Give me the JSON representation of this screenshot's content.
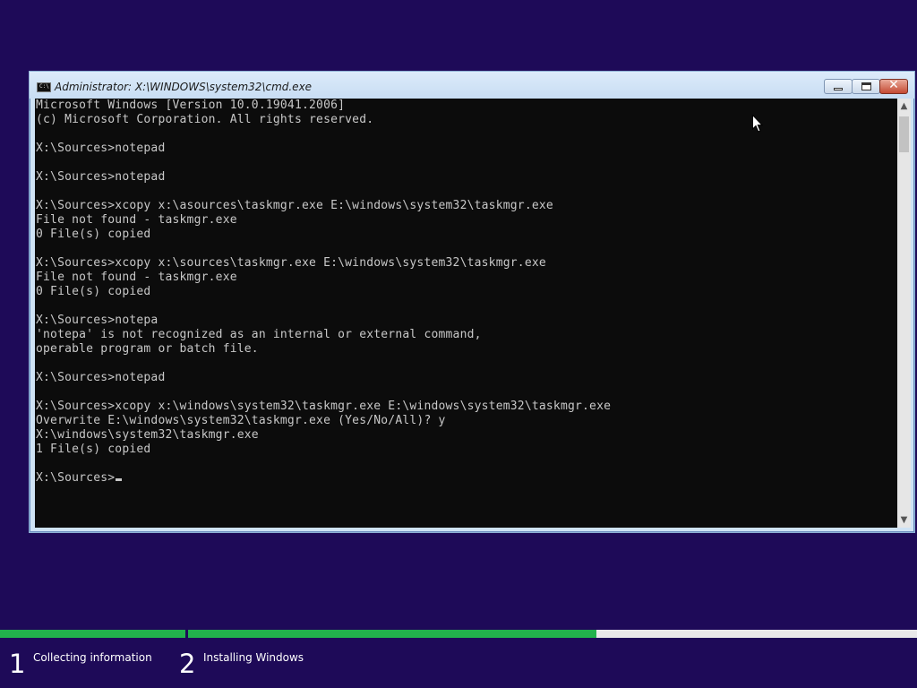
{
  "window": {
    "title": "Administrator: X:\\WINDOWS\\system32\\cmd.exe",
    "icon": "cmd-prompt-icon",
    "icon_text": "C:\\",
    "close_glyph": "✕"
  },
  "console": {
    "lines": [
      "Microsoft Windows [Version 10.0.19041.2006]",
      "(c) Microsoft Corporation. All rights reserved.",
      "",
      "X:\\Sources>notepad",
      "",
      "X:\\Sources>notepad",
      "",
      "X:\\Sources>xcopy x:\\asources\\taskmgr.exe E:\\windows\\system32\\taskmgr.exe",
      "File not found - taskmgr.exe",
      "0 File(s) copied",
      "",
      "X:\\Sources>xcopy x:\\sources\\taskmgr.exe E:\\windows\\system32\\taskmgr.exe",
      "File not found - taskmgr.exe",
      "0 File(s) copied",
      "",
      "X:\\Sources>notepa",
      "'notepa' is not recognized as an internal or external command,",
      "operable program or batch file.",
      "",
      "X:\\Sources>notepad",
      "",
      "X:\\Sources>xcopy x:\\windows\\system32\\taskmgr.exe E:\\windows\\system32\\taskmgr.exe",
      "Overwrite E:\\windows\\system32\\taskmgr.exe (Yes/No/All)? y",
      "X:\\windows\\system32\\taskmgr.exe",
      "1 File(s) copied",
      ""
    ],
    "prompt": "X:\\Sources>",
    "foreground": "#c8c8c8",
    "background": "#0c0c0c"
  },
  "scrollbar": {
    "up_glyph": "▲",
    "down_glyph": "▼"
  },
  "setup": {
    "background": "#1e0a58",
    "progress_color": "#22b24c",
    "steps": [
      {
        "number": "1",
        "label": "Collecting information"
      },
      {
        "number": "2",
        "label": "Installing Windows"
      }
    ]
  }
}
